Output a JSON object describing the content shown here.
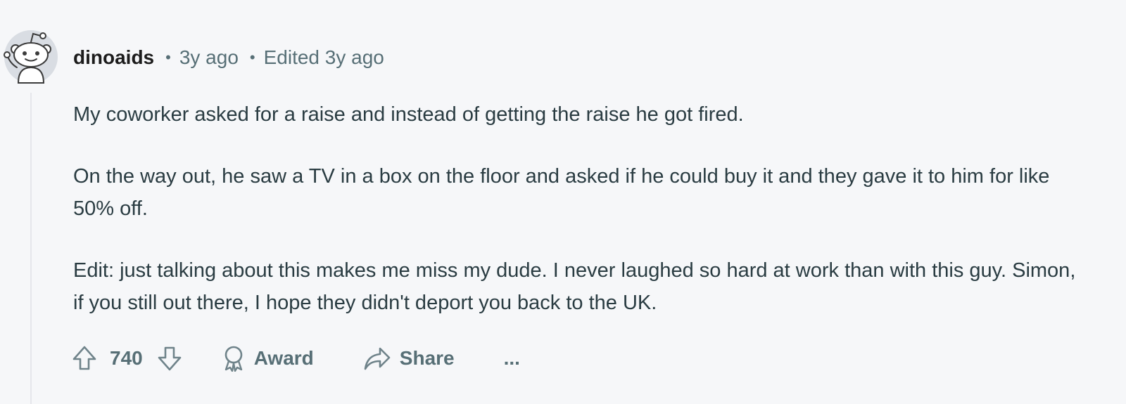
{
  "comment": {
    "author": "dinoaids",
    "separator": "•",
    "posted": "3y ago",
    "edited": "Edited 3y ago",
    "paragraphs": [
      "My coworker asked for a raise and instead of getting the raise he got fired.",
      "On the way out, he saw a TV in a box on the floor and asked if he could buy it and they gave it to him for like 50% off.",
      "Edit: just talking about this makes me miss my dude. I never laughed so hard at work than with this guy. Simon, if you still out there, I hope they didn't deport you back to the UK."
    ],
    "score": "740",
    "award_label": "Award",
    "share_label": "Share",
    "more_label": "..."
  },
  "colors": {
    "background": "#f6f7f9",
    "text": "#2a3c42",
    "muted": "#576f76",
    "thread_line": "#e5e7eb"
  },
  "icons": {
    "avatar": "snoo-avatar-icon",
    "upvote": "upvote-arrow-icon",
    "downvote": "downvote-arrow-icon",
    "award": "award-ribbon-icon",
    "share": "share-arrow-icon"
  }
}
